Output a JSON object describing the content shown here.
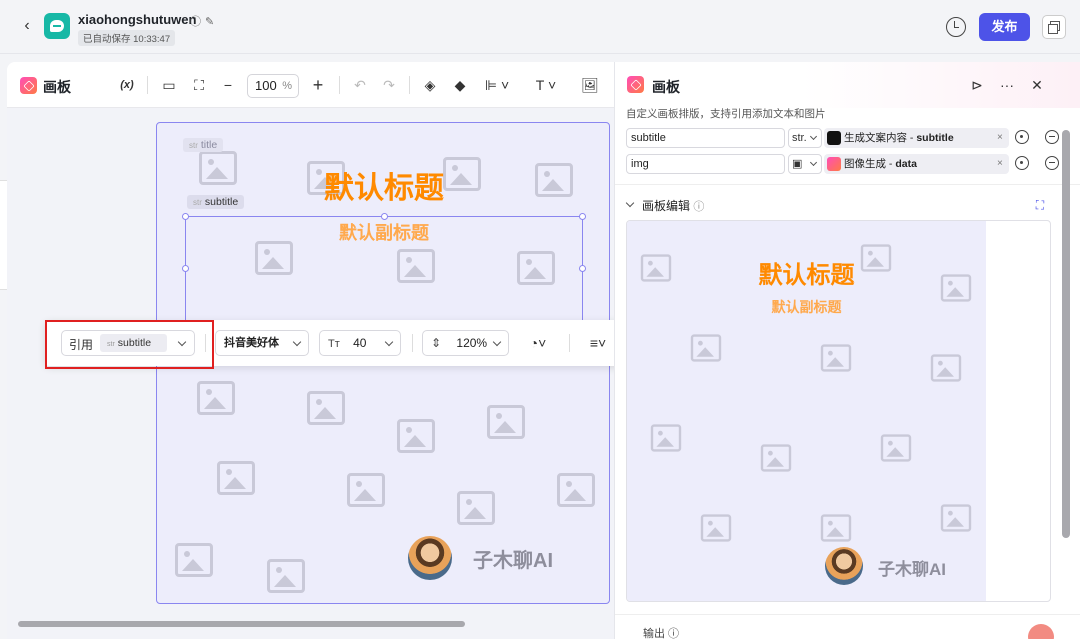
{
  "header": {
    "back_icon": "back-arrow-icon",
    "app_name": "xiaohongshutuwen",
    "autosave": "已自动保存 10:33:47",
    "publish_label": "发布",
    "accent_color": "#4d53e8"
  },
  "editor": {
    "title": "画板",
    "variable_btn": "(x)",
    "zoom_value": "100",
    "zoom_unit": "%",
    "minus": "−",
    "plus": "+",
    "text_tool": "T"
  },
  "canvas": {
    "title_tag": "title",
    "subtitle_tag": "subtitle",
    "title_text": "默认标题",
    "subtitle_text": "默认副标题",
    "brand": "子木聊AI",
    "title_color": "#ff8a00"
  },
  "format_bar": {
    "ref_label": "引用",
    "ref_value": "subtitle",
    "font": "抖音美好体",
    "size_icon": "Tт",
    "font_size": "40",
    "line_height": "120%"
  },
  "right_panel": {
    "title": "画板",
    "description": "自定义画板排版，支持引用添加文本和图片",
    "variables": [
      {
        "name": "subtitle",
        "type": "str.",
        "source_prefix": "生成文案内容 - ",
        "source_field": "subtitle"
      },
      {
        "name": "img",
        "type": "",
        "source_prefix": "图像生成 - ",
        "source_field": "data"
      }
    ],
    "section_title": "画板编辑",
    "preview_title": "默认标题",
    "preview_subtitle": "默认副标题",
    "preview_brand": "子木聊AI",
    "output_label": "输出"
  }
}
